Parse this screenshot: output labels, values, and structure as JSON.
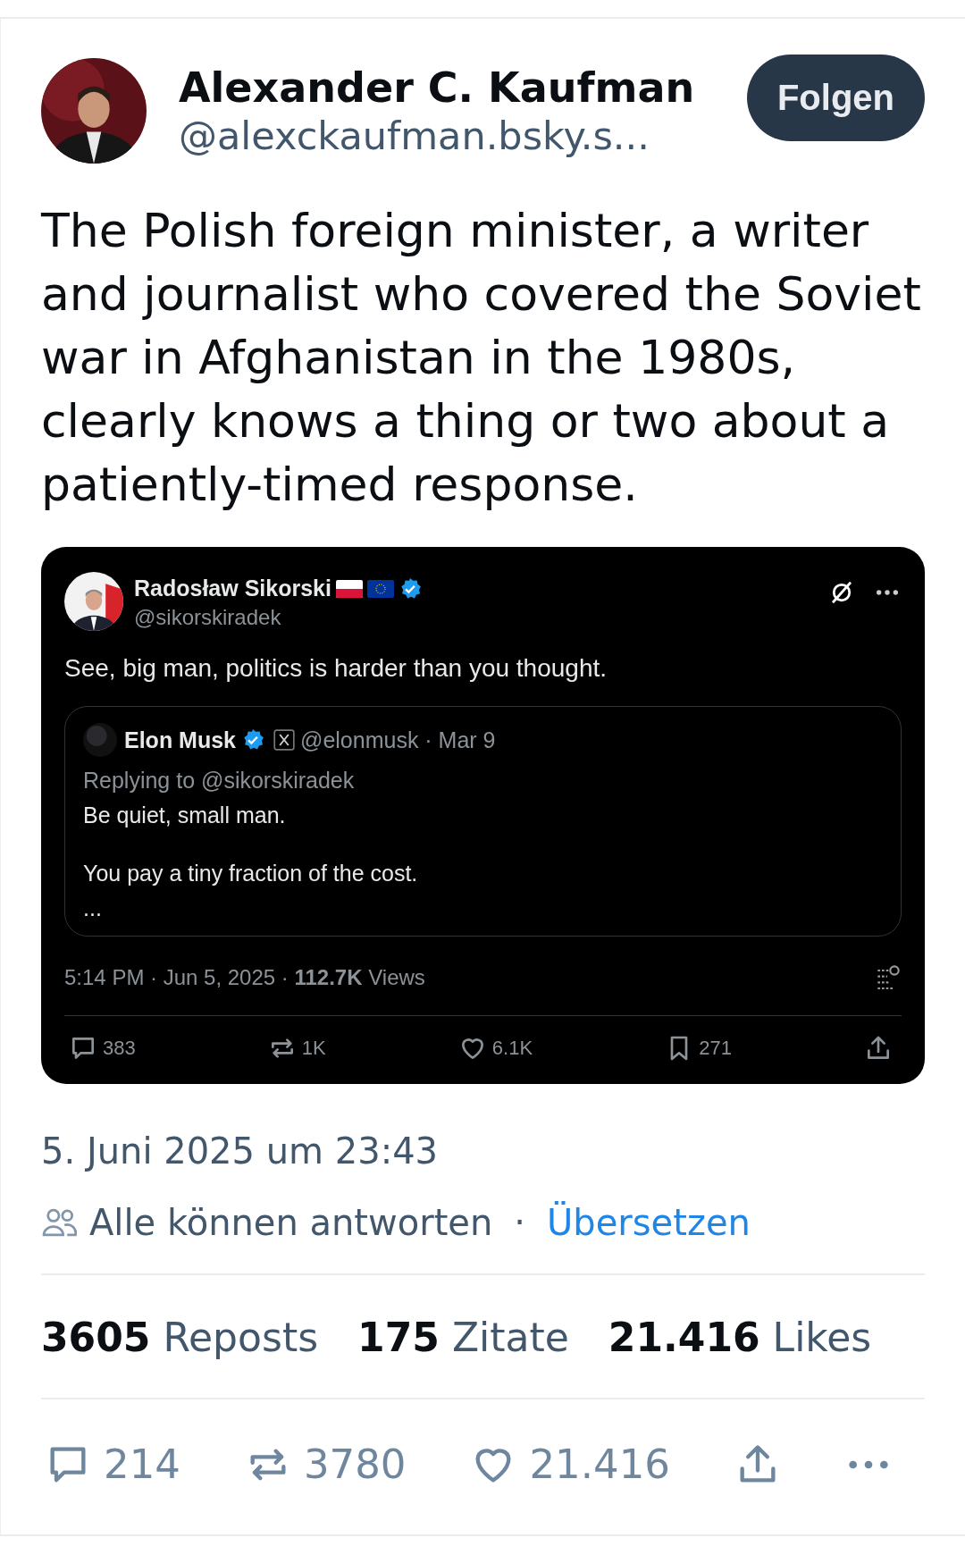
{
  "author": {
    "name": "Alexander C. Kaufman",
    "handle": "@alexckaufman.bsky.s..."
  },
  "follow_button": "Folgen",
  "text": "The Polish foreign minister, a writer and journalist who covered the Soviet war in Afghanistan in the 1980s, clearly knows a thing or two about a patiently-timed response.",
  "embed": {
    "author": {
      "name": "Radosław Sikorski",
      "handle": "@sikorskiradek",
      "verified": true
    },
    "text": "See, big man, politics is harder than you thought.",
    "quote": {
      "name": "Elon Musk",
      "verified": true,
      "meta": "@elonmusk · Mar 9",
      "replying": "Replying to @sikorskiradek",
      "lines": [
        "Be quiet, small man.",
        "You pay a tiny fraction of the cost.",
        "..."
      ]
    },
    "timestamp": "5:14 PM · Jun 5, 2025 · **112.7K** Views",
    "actions": [
      {
        "kind": "reply",
        "count": "383"
      },
      {
        "kind": "repost",
        "count": "1K"
      },
      {
        "kind": "like",
        "count": "6.1K"
      },
      {
        "kind": "bookmark",
        "count": "271"
      },
      {
        "kind": "share"
      }
    ]
  },
  "date": "5. Juni 2025 um 23:43",
  "reply_setting": "Alle können antworten",
  "separator": "·",
  "translate_link": "Übersetzen",
  "stats": [
    {
      "count": "3605",
      "label": "Reposts"
    },
    {
      "count": "175",
      "label": "Zitate"
    },
    {
      "count": "21.416",
      "label": "Likes"
    }
  ],
  "actions": [
    {
      "kind": "reply",
      "count": "214"
    },
    {
      "kind": "repost",
      "count": "3780"
    },
    {
      "kind": "like",
      "count": "21.416"
    },
    {
      "kind": "share"
    },
    {
      "kind": "more"
    }
  ]
}
